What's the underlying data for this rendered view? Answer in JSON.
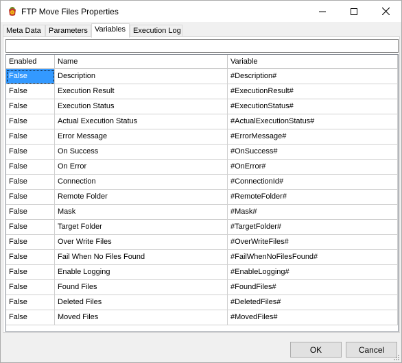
{
  "window": {
    "title": "FTP Move Files Properties",
    "icon": "ftp-app-icon"
  },
  "tabs": [
    {
      "label": "Meta Data"
    },
    {
      "label": "Parameters"
    },
    {
      "label": "Variables"
    },
    {
      "label": "Execution Log"
    }
  ],
  "active_tab": "Variables",
  "filter": {
    "value": "",
    "placeholder": ""
  },
  "grid": {
    "columns": [
      "Enabled",
      "Name",
      "Variable"
    ],
    "rows": [
      {
        "enabled": "False",
        "name": "Description",
        "variable": "#Description#"
      },
      {
        "enabled": "False",
        "name": "Execution Result",
        "variable": "#ExecutionResult#"
      },
      {
        "enabled": "False",
        "name": "Execution Status",
        "variable": "#ExecutionStatus#"
      },
      {
        "enabled": "False",
        "name": "Actual Execution Status",
        "variable": "#ActualExecutionStatus#"
      },
      {
        "enabled": "False",
        "name": "Error Message",
        "variable": "#ErrorMessage#"
      },
      {
        "enabled": "False",
        "name": "On Success",
        "variable": "#OnSuccess#"
      },
      {
        "enabled": "False",
        "name": "On Error",
        "variable": "#OnError#"
      },
      {
        "enabled": "False",
        "name": "Connection",
        "variable": "#ConnectionId#"
      },
      {
        "enabled": "False",
        "name": "Remote Folder",
        "variable": "#RemoteFolder#"
      },
      {
        "enabled": "False",
        "name": "Mask",
        "variable": "#Mask#"
      },
      {
        "enabled": "False",
        "name": "Target Folder",
        "variable": "#TargetFolder#"
      },
      {
        "enabled": "False",
        "name": "Over Write Files",
        "variable": "#OverWriteFiles#"
      },
      {
        "enabled": "False",
        "name": "Fail When No Files Found",
        "variable": "#FailWhenNoFilesFound#"
      },
      {
        "enabled": "False",
        "name": "Enable Logging",
        "variable": "#EnableLogging#"
      },
      {
        "enabled": "False",
        "name": "Found Files",
        "variable": "#FoundFiles#"
      },
      {
        "enabled": "False",
        "name": "Deleted Files",
        "variable": "#DeletedFiles#"
      },
      {
        "enabled": "False",
        "name": "Moved Files",
        "variable": "#MovedFiles#"
      }
    ]
  },
  "buttons": {
    "ok": "OK",
    "cancel": "Cancel"
  },
  "colors": {
    "selection": "#3399ff",
    "button_face": "#e1e1e1"
  }
}
